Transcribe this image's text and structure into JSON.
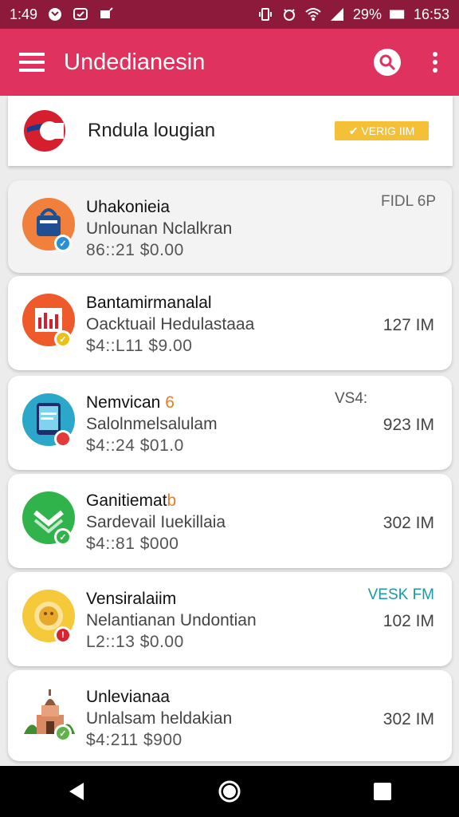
{
  "status_bar": {
    "time_left": "1:49",
    "battery_percent": "29%",
    "clock": "16:53",
    "icons": [
      "chat-bubble-icon",
      "message-icon",
      "notification-icon",
      "vibrate-icon",
      "alarm-icon",
      "wifi-icon",
      "signal-icon",
      "battery-icon"
    ]
  },
  "app_bar": {
    "title": "Undedianesin",
    "icons": [
      "menu-icon",
      "search-icon",
      "more-vert-icon"
    ],
    "color": "#e0325f"
  },
  "top_card": {
    "title": "Rndula lougian",
    "badge": "✔ VERIG IIM",
    "badge_color": "#f4c036"
  },
  "apps": [
    {
      "title": "Uhakonieia",
      "title_accent": "",
      "subtitle": "Unlounan Nclalkran",
      "price": "86::21  $0.00",
      "size": "",
      "tag": "FIDL 6P",
      "icon": "shopping-bag-icon",
      "icon_bg": "#f0803c",
      "badge_color": "#2b8fd6"
    },
    {
      "title": "Bantamirmanalal",
      "title_accent": "",
      "subtitle": "Oacktuail Hedulastaaa",
      "price": "$4::L11  $9.00",
      "size": "127 IM",
      "tag": "",
      "icon": "chart-icon",
      "icon_bg": "#ef5a2a",
      "badge_color": "#e7c21c"
    },
    {
      "title": "Nemvican ",
      "title_accent": "6",
      "subtitle": "Salolnmelsalulam",
      "price": "$4::24  $01.0",
      "size": "923 IM",
      "tag": "VS4:",
      "icon": "tablet-icon",
      "icon_bg": "#2aa7c9",
      "badge_color": "#e23b3b"
    },
    {
      "title": "Ganitiemat",
      "title_accent": "b",
      "subtitle": "Sardevail Iuekillaia",
      "price": "$4::81  $000",
      "size": "302 IM",
      "tag": "",
      "icon": "check-icon",
      "icon_bg": "#2fb34a",
      "badge_color": "#2fb34a"
    },
    {
      "title": "Vensiralaiim",
      "title_accent": "",
      "subtitle": "Nelantianan Undontian",
      "price": "L2::13  $0.00",
      "size": "102 IM",
      "tag": "VESK FM",
      "icon": "face-icon",
      "icon_bg": "#f5c93a",
      "badge_color": "#d9232f"
    },
    {
      "title": "Unlevianaa",
      "title_accent": "",
      "subtitle": "Unlalsam heldakian",
      "price": "$4:211  $900",
      "size": "302 IM",
      "tag": "",
      "icon": "temple-icon",
      "icon_bg": "#ffffff",
      "badge_color": "#5fb34a"
    }
  ],
  "nav_bar": {
    "icons": [
      "back-icon",
      "home-icon",
      "recents-icon"
    ]
  }
}
